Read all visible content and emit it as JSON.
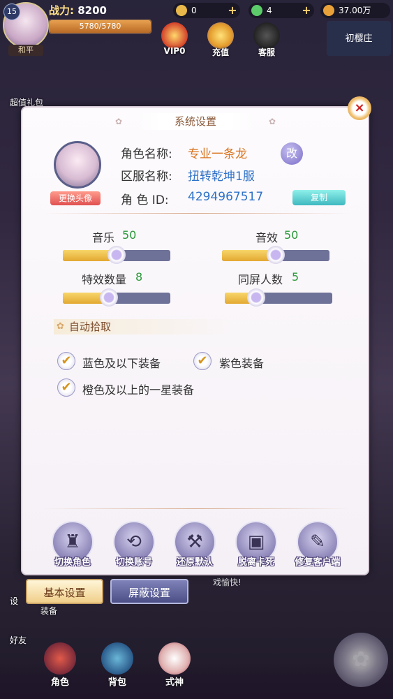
{
  "hud": {
    "level": "15",
    "player_name": "和平",
    "power_label": "战力:",
    "power_value": "8200",
    "exp_text": "5780/5780",
    "exp_progress": 1.0,
    "resources": [
      {
        "name": "gold-ingot",
        "value": "0",
        "color": "#e8b84a"
      },
      {
        "name": "green-gem",
        "value": "4",
        "color": "#5ccc6a"
      },
      {
        "name": "coin",
        "value": "37.00万",
        "color": "#e9a13a"
      }
    ],
    "vip_label": "VIP0",
    "recharge_label": "充值",
    "service_label": "客服",
    "server_name": "初樱庄"
  },
  "side": {
    "gift_label": "超值礼包",
    "settings_label": "设",
    "friends_label": "好友",
    "equip_label": "装备",
    "chat_text": "戏愉快!"
  },
  "dialog": {
    "title": "系统设置",
    "close": "×",
    "change_avatar": "更换头像",
    "role_name_label": "角色名称:",
    "role_name": "专业一条龙",
    "rename": "改",
    "server_label": "区服名称:",
    "server": "扭转乾坤1服",
    "role_id_label": "角 色 ID:",
    "role_id": "4294967517",
    "copy": "复制",
    "sliders": [
      {
        "label": "音乐",
        "value": "50",
        "level": 0.5
      },
      {
        "label": "音效",
        "value": "50",
        "level": 0.5
      },
      {
        "label": "特效数量",
        "value": "8",
        "level": 0.43
      },
      {
        "label": "同屏人数",
        "value": "5",
        "level": 0.29
      }
    ],
    "auto_pickup_title": "自动拾取",
    "checkboxes": [
      {
        "label": "蓝色及以下装备",
        "checked": true
      },
      {
        "label": "紫色装备",
        "checked": true
      },
      {
        "label": "橙色及以上的一星装备",
        "checked": true
      }
    ],
    "actions": [
      {
        "label": "切换角色",
        "icon": "helmet-icon",
        "glyph": "♜"
      },
      {
        "label": "切换账号",
        "icon": "swap-icon",
        "glyph": "⟲"
      },
      {
        "label": "还原默认",
        "icon": "tools-icon",
        "glyph": "⚒"
      },
      {
        "label": "脱离卡死",
        "icon": "monitor-icon",
        "glyph": "▣"
      },
      {
        "label": "修复客户端",
        "icon": "repair-icon",
        "glyph": "✎"
      }
    ]
  },
  "tabs": {
    "basic": "基本设置",
    "shield": "屏蔽设置"
  },
  "bottom": {
    "role": "角色",
    "bag": "背包",
    "shikigami": "式神"
  }
}
